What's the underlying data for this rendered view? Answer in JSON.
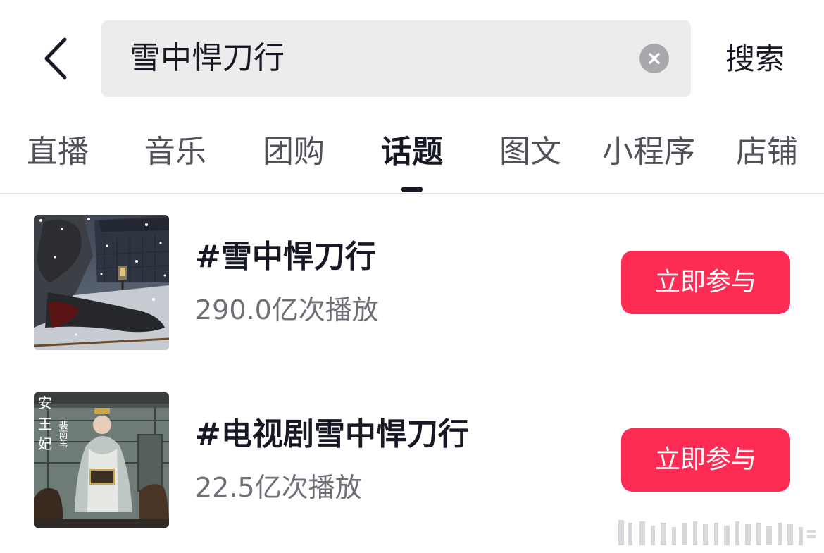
{
  "search": {
    "query": "雪中悍刀行",
    "submit_label": "搜索"
  },
  "tabs": [
    {
      "label": "直播"
    },
    {
      "label": "音乐"
    },
    {
      "label": "团购"
    },
    {
      "label": "话题",
      "active": true
    },
    {
      "label": "图文"
    },
    {
      "label": "小程序"
    },
    {
      "label": "店铺"
    }
  ],
  "topics": [
    {
      "title": "#雪中悍刀行",
      "stats": "290.0亿次播放",
      "button_label": "立即参与"
    },
    {
      "title": "#电视剧雪中悍刀行",
      "stats": "22.5亿次播放",
      "button_label": "立即参与",
      "poster_text": [
        "安",
        "王",
        "妃",
        "裴南苇"
      ]
    }
  ],
  "colors": {
    "accent": "#fe2c55",
    "search_bg": "#ececec",
    "active_tab": "#161823",
    "secondary_text": "#6f7077"
  }
}
